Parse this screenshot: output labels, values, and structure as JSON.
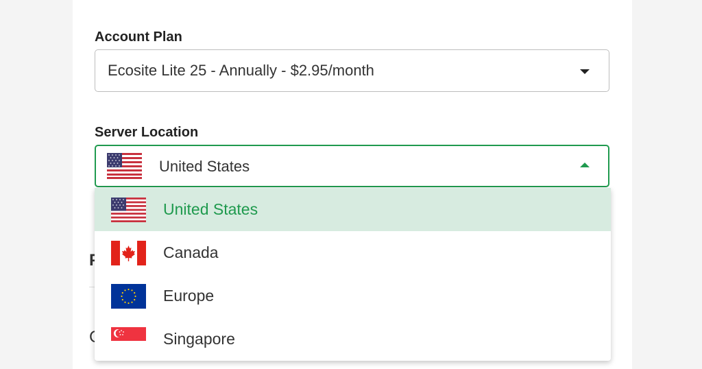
{
  "account_plan": {
    "label": "Account Plan",
    "selected": "Ecosite Lite 25 - Annually - $2.95/month"
  },
  "server_location": {
    "label": "Server Location",
    "selected": "United States",
    "selected_flag": "us-flag-icon",
    "options": [
      {
        "label": "United States",
        "flag": "us-flag-icon",
        "selected": true
      },
      {
        "label": "Canada",
        "flag": "canada-flag-icon",
        "selected": false
      },
      {
        "label": "Europe",
        "flag": "eu-flag-icon",
        "selected": false
      },
      {
        "label": "Singapore",
        "flag": "singapore-flag-icon",
        "selected": false
      }
    ]
  },
  "colors": {
    "accent": "#1f9a4e",
    "selected_bg": "#d7ebe0",
    "border": "#bdbdbd"
  }
}
